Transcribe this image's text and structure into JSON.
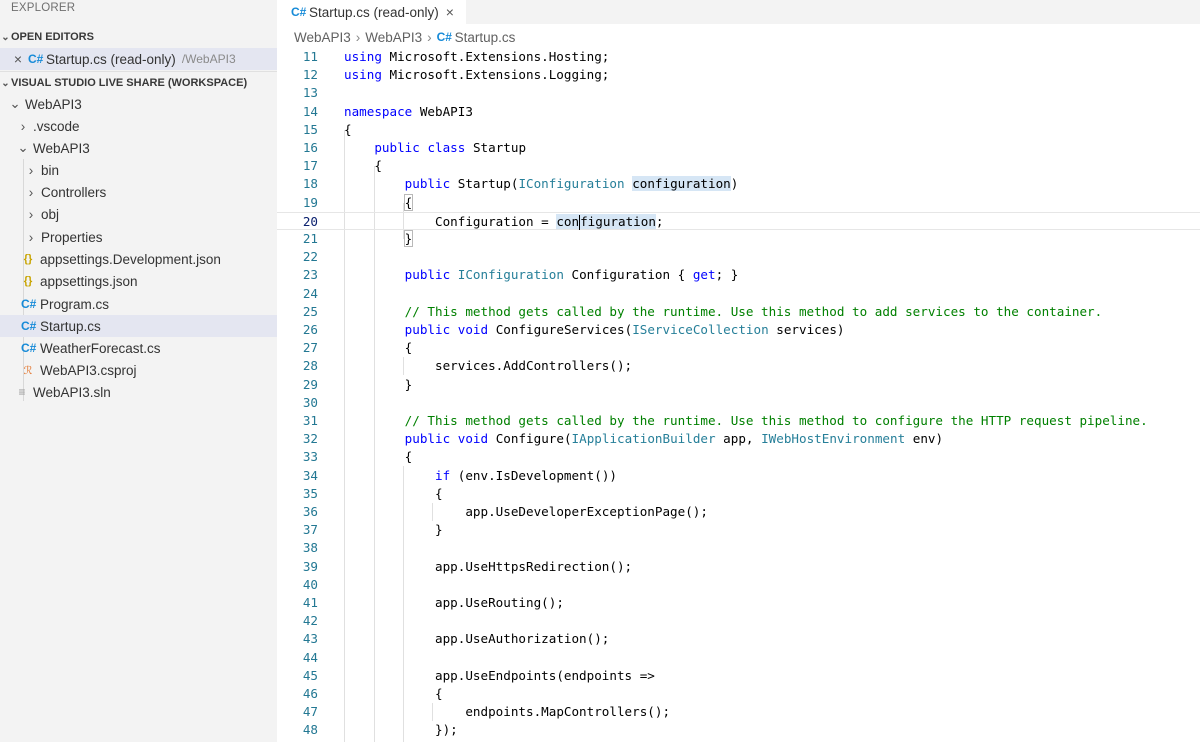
{
  "explorer": {
    "title": "EXPLORER",
    "open_editors": {
      "header": "OPEN EDITORS",
      "item": {
        "label": "Startup.cs (read-only)",
        "path": "/WebAPI3",
        "icon": "csharp-icon"
      }
    },
    "workspace": {
      "header": "VISUAL STUDIO LIVE SHARE (WORKSPACE)",
      "root": "WebAPI3",
      "items": [
        {
          "label": ".vscode",
          "kind": "folder"
        },
        {
          "label": "WebAPI3",
          "kind": "folder-open"
        },
        {
          "label": "bin",
          "kind": "folder"
        },
        {
          "label": "Controllers",
          "kind": "folder"
        },
        {
          "label": "obj",
          "kind": "folder"
        },
        {
          "label": "Properties",
          "kind": "folder"
        },
        {
          "label": "appsettings.Development.json",
          "kind": "json"
        },
        {
          "label": "appsettings.json",
          "kind": "json"
        },
        {
          "label": "Program.cs",
          "kind": "cs"
        },
        {
          "label": "Startup.cs",
          "kind": "cs",
          "selected": true
        },
        {
          "label": "WeatherForecast.cs",
          "kind": "cs"
        },
        {
          "label": "WebAPI3.csproj",
          "kind": "csproj"
        },
        {
          "label": "WebAPI3.sln",
          "kind": "sln"
        }
      ]
    }
  },
  "tab": {
    "label": "Startup.cs (read-only)"
  },
  "breadcrumb": [
    "WebAPI3",
    "WebAPI3",
    "Startup.cs"
  ],
  "icons": {
    "csharp": "C#",
    "chevron_right": "›",
    "chevron_down": "⌄",
    "close": "×"
  },
  "colors": {
    "keyword": "#0000ff",
    "type": "#267f99",
    "comment": "#008000",
    "line_number": "#237893",
    "selection": "#e4e6f1"
  },
  "code": {
    "l11": [
      "using",
      " Microsoft.Extensions.Hosting;"
    ],
    "l12": [
      "using",
      " Microsoft.Extensions.Logging;"
    ],
    "l14": [
      "namespace",
      " WebAPI3"
    ],
    "l15": "{",
    "l16": [
      "public",
      "class",
      "Startup"
    ],
    "l17": "{",
    "l18": [
      "public",
      "Startup(",
      "IConfiguration",
      "configuration",
      ")"
    ],
    "l19": "{",
    "l20": [
      "Configuration = ",
      "con",
      "figuration",
      ";"
    ],
    "l21": "}",
    "l23": [
      "public",
      "IConfiguration",
      " Configuration { ",
      "get",
      "; }"
    ],
    "l25": "// This method gets called by the runtime. Use this method to add services to the container.",
    "l26": [
      "public",
      "void",
      "ConfigureServices(",
      "IServiceCollection",
      " services)"
    ],
    "l27": "{",
    "l28": "services.AddControllers();",
    "l29": "}",
    "l31": "// This method gets called by the runtime. Use this method to configure the HTTP request pipeline.",
    "l32": [
      "public",
      "void",
      "Configure(",
      "IApplicationBuilder",
      " app, ",
      "IWebHostEnvironment",
      " env)"
    ],
    "l33": "{",
    "l34": [
      "if",
      " (env.IsDevelopment())"
    ],
    "l35": "{",
    "l36": "app.UseDeveloperExceptionPage();",
    "l37": "}",
    "l39": "app.UseHttpsRedirection();",
    "l41": "app.UseRouting();",
    "l43": "app.UseAuthorization();",
    "l45": "app.UseEndpoints(endpoints =>",
    "l46": "{",
    "l47": "endpoints.MapControllers();",
    "l48": "});"
  },
  "line_numbers": [
    "11",
    "12",
    "13",
    "14",
    "15",
    "16",
    "17",
    "18",
    "19",
    "20",
    "21",
    "22",
    "23",
    "24",
    "25",
    "26",
    "27",
    "28",
    "29",
    "30",
    "31",
    "32",
    "33",
    "34",
    "35",
    "36",
    "37",
    "38",
    "39",
    "40",
    "41",
    "42",
    "43",
    "44",
    "45",
    "46",
    "47",
    "48"
  ]
}
